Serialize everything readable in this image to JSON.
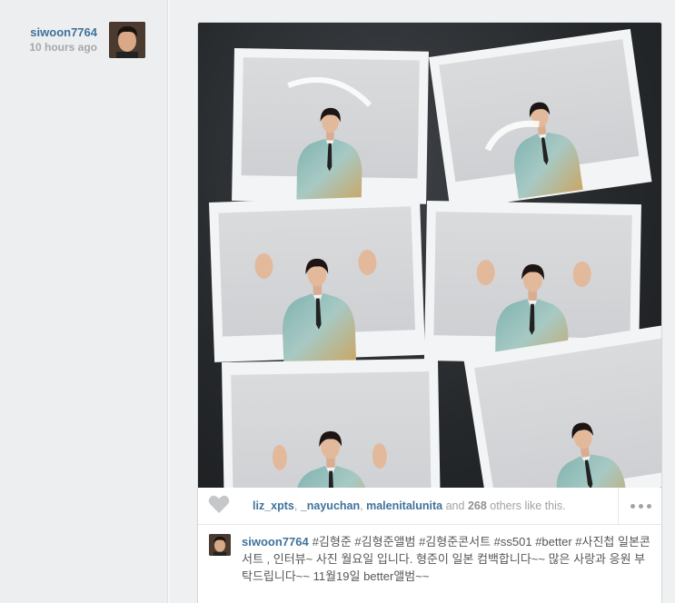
{
  "post": {
    "author": "siwoon7764",
    "time": "10 hours ago",
    "likes": {
      "names": [
        "liz_xpts",
        "_nayuchan",
        "malenitalunita"
      ],
      "sep1": ", ",
      "sep2": ", ",
      "and_text": " and ",
      "count": "268",
      "suffix": " others like this."
    },
    "caption": {
      "user": "siwoon7764",
      "text": "#김형준 #김형준앨범 #김형준콘서트 #ss501 #better #사진첩 일본콘서트 , 인터뷰~ 사진 월요일 입니다. 형준이 일본 컴백합니다~~ 많은 사랑과 응원 부탁드립니다~~ 11월19일 better앨범~~"
    }
  },
  "icons": {
    "like": "heart-icon",
    "more": "ellipsis-icon"
  },
  "colors": {
    "link": "#3f729b",
    "muted": "#a5a7aa"
  }
}
